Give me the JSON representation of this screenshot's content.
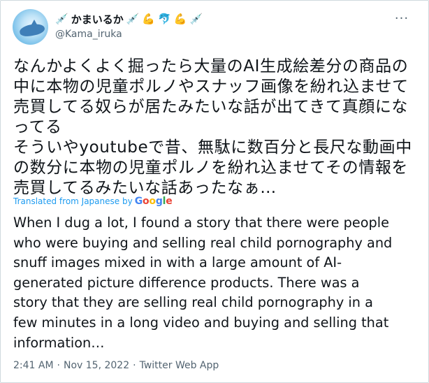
{
  "author": {
    "display_name": "かまいるか",
    "emojis": [
      "💉",
      "💪",
      "🐬",
      "💪",
      "💉"
    ],
    "handle": "@Kama_iruka"
  },
  "more_menu": {
    "glyph": "···"
  },
  "tweet": {
    "original_text": "なんかよくよく掘ったら大量のAI生成絵差分の商品の\n中に本物の児童ポルノやスナッフ画像を紛れ込ませて\n売買してる奴らが居たみたいな話が出てきて真顔にな\nってる\nそういやyoutubeで昔、無駄に数百分と長尺な動画中\nの数分に本物の児童ポルノを紛れ込ませてその情報を\n売買してるみたいな話あったなぁ…",
    "translated_label": "Translated from Japanese by",
    "translator_name": "Google",
    "google_colors": [
      "#4285F4",
      "#EA4335",
      "#FBBC05",
      "#4285F4",
      "#34A853",
      "#EA4335"
    ],
    "translated_text": "When I dug a lot, I found a story that there were people\nwho were buying and selling real child pornography and\nsnuff images mixed in with a large amount of AI-\ngenerated picture difference products. There was a\nstory that they are selling real child pornography in a\nfew minutes in a long video and buying and selling that\ninformation…"
  },
  "meta": {
    "time": "2:41 AM",
    "separator": "·",
    "date": "Nov 15, 2022",
    "source": "Twitter Web App"
  },
  "colors": {
    "link": "#1d9bf0",
    "muted": "#536471",
    "text": "#0f1419",
    "border": "#cfd9de"
  }
}
